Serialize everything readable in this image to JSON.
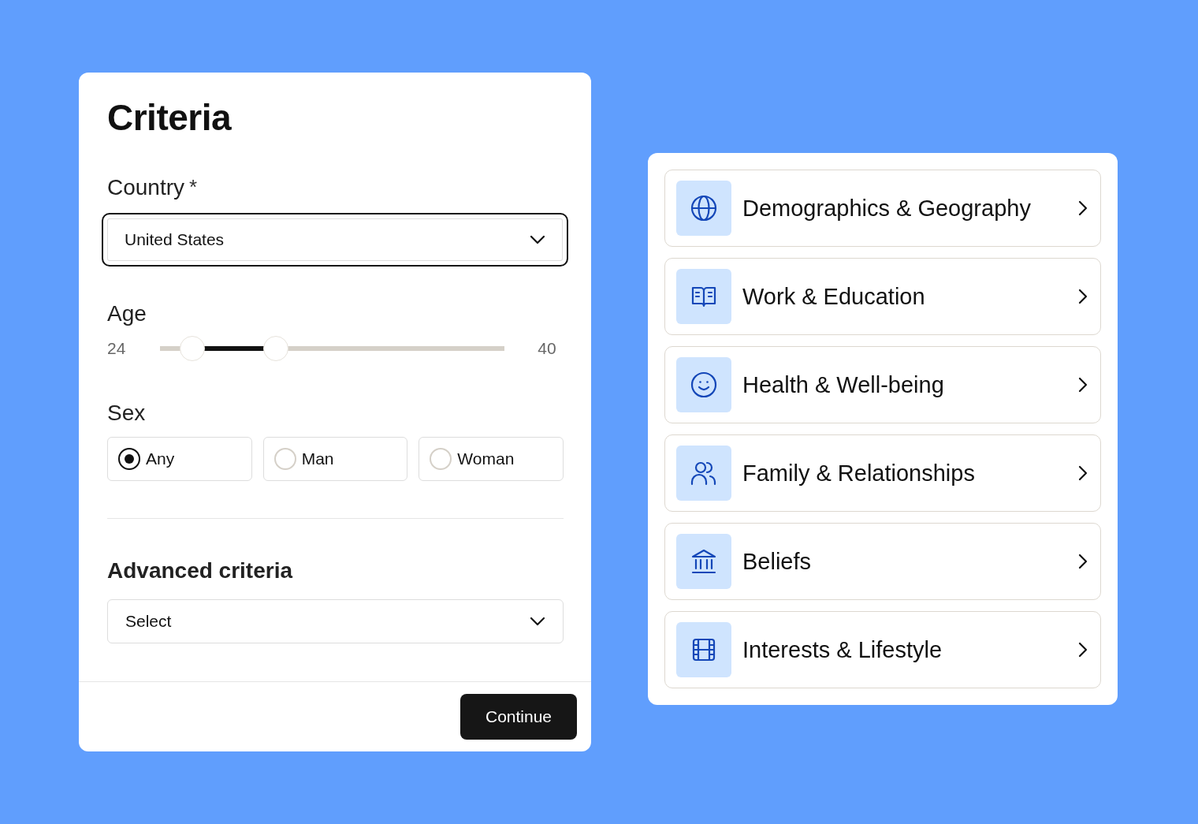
{
  "criteria": {
    "title": "Criteria",
    "country": {
      "label": "Country",
      "required_mark": "*",
      "value": "United States",
      "focused": true
    },
    "age": {
      "label": "Age",
      "min_reading": "24",
      "max_reading": "40",
      "thumbs": [
        {
          "level": 0.094
        },
        {
          "level": 0.336
        }
      ]
    },
    "sex": {
      "label": "Sex",
      "options": [
        {
          "label": "Any",
          "selected": true
        },
        {
          "label": "Man",
          "selected": false
        },
        {
          "label": "Woman",
          "selected": false
        }
      ]
    },
    "advanced": {
      "label": "Advanced criteria",
      "placeholder": "Select"
    },
    "continue_button": "Continue"
  },
  "categories": [
    {
      "kind": "globe",
      "label": "Demographics & Geography"
    },
    {
      "kind": "book",
      "label": "Work & Education"
    },
    {
      "kind": "smile",
      "label": "Health & Well-being"
    },
    {
      "kind": "people",
      "label": "Family & Relationships"
    },
    {
      "kind": "temple",
      "label": "Beliefs"
    },
    {
      "kind": "film",
      "label": "Interests & Lifestyle"
    }
  ]
}
